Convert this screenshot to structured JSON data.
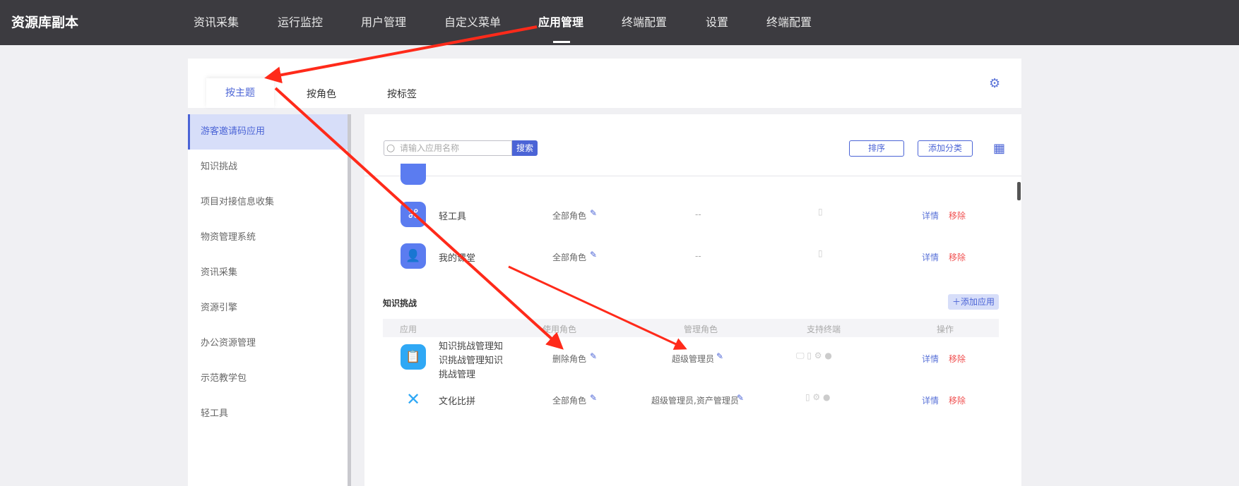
{
  "header": {
    "brand": "资源库副本",
    "nav": [
      "资讯采集",
      "运行监控",
      "用户管理",
      "自定义菜单",
      "应用管理",
      "终端配置",
      "设置",
      "终端配置"
    ],
    "active_index": 4
  },
  "tabs": [
    "按主题",
    "按角色",
    "按标签"
  ],
  "sidebar": {
    "items": [
      "游客邀请码应用",
      "知识挑战",
      "项目对接信息收集",
      "物资管理系统",
      "资讯采集",
      "资源引擎",
      "办公资源管理",
      "示范教学包",
      "轻工具"
    ]
  },
  "toolbar": {
    "search_placeholder": "请输入应用名称",
    "search_label": "搜索",
    "sort_label": "排序",
    "add_category_label": "添加分类"
  },
  "group1": {
    "rows": [
      {
        "name": "轻工具",
        "use_role": "全部角色",
        "admin_role": "--",
        "detail": "详情",
        "remove": "移除"
      },
      {
        "name": "我的课堂",
        "use_role": "全部角色",
        "admin_role": "--",
        "detail": "详情",
        "remove": "移除"
      }
    ]
  },
  "group2": {
    "title": "知识挑战",
    "add_label": "添加应用",
    "columns": [
      "应用",
      "使用角色",
      "管理角色",
      "支持终端",
      "操作"
    ],
    "rows": [
      {
        "name": "知识挑战管理知识挑战管理知识挑战管理",
        "name_lines": [
          "知识挑战管理知",
          "识挑战管理知识",
          "挑战管理"
        ],
        "use_role": "删除角色",
        "admin_role": "超级管理员",
        "detail": "详情",
        "remove": "移除"
      },
      {
        "name": "文化比拼",
        "use_role": "全部角色",
        "admin_role": "超级管理员,资产管理员",
        "detail": "详情",
        "remove": "移除"
      }
    ]
  },
  "colors": {
    "accent": "#4b64d6",
    "header_bg": "#3c3b40",
    "annotation": "#ff2a1a",
    "remove": "#f05050"
  }
}
